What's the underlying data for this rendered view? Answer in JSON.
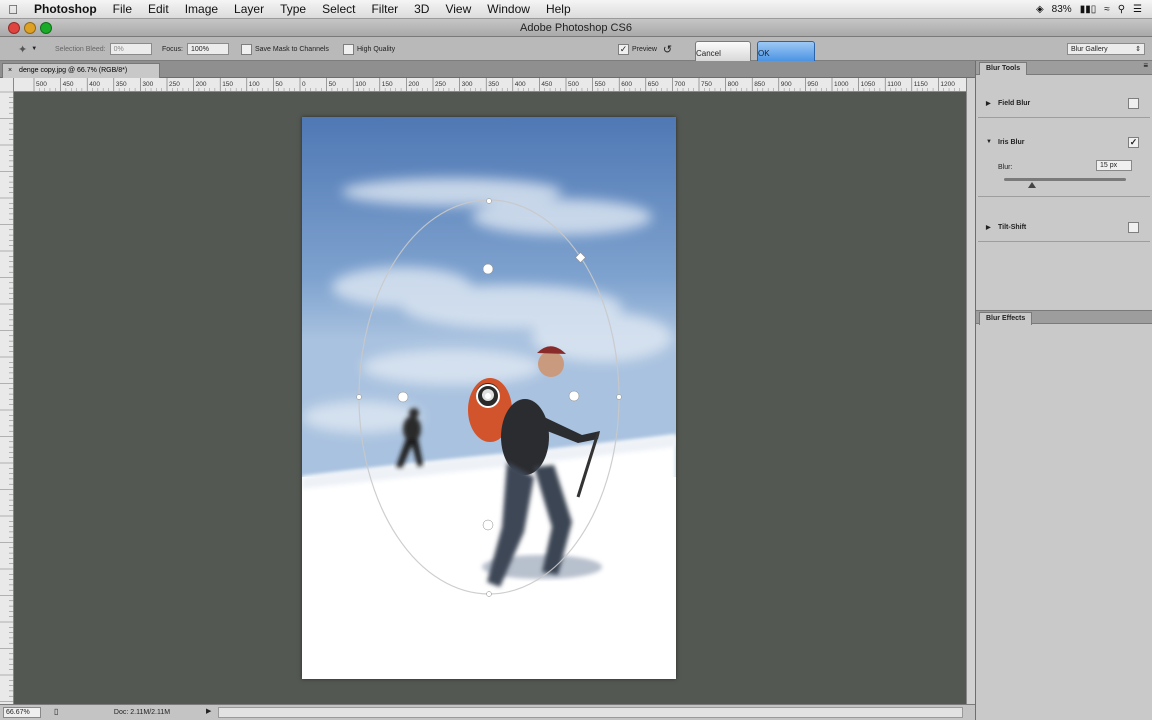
{
  "menubar": {
    "apple_icon": "apple-logo-icon",
    "app_name": "Photoshop",
    "items": [
      "File",
      "Edit",
      "Image",
      "Layer",
      "Type",
      "Select",
      "Filter",
      "3D",
      "View",
      "Window",
      "Help"
    ],
    "battery": "83%"
  },
  "window": {
    "title": "Adobe Photoshop CS6"
  },
  "options_bar": {
    "selection_bleed_label": "Selection Bleed:",
    "selection_bleed_value": "0%",
    "focus_label": "Focus:",
    "focus_value": "100%",
    "save_mask_label": "Save Mask to Channels",
    "high_quality_label": "High Quality",
    "preview_label": "Preview",
    "preview_checked": true,
    "cancel_label": "Cancel",
    "ok_label": "OK",
    "workspace_value": "Blur Gallery"
  },
  "document": {
    "tab_label": "denge copy.jpg @ 66.7% (RGB/8*)",
    "ruler_ticks": [
      "500",
      "450",
      "400",
      "350",
      "300",
      "250",
      "200",
      "150",
      "100",
      "50",
      "0",
      "50",
      "100",
      "150",
      "200",
      "250",
      "300",
      "350",
      "400",
      "450",
      "500",
      "550",
      "600",
      "650",
      "700",
      "750",
      "800",
      "850",
      "900",
      "950",
      "1000",
      "1050",
      "1100",
      "1150",
      "1200"
    ]
  },
  "status_bar": {
    "zoom": "66.67%",
    "doc_info": "Doc: 2.11M/2.11M"
  },
  "blur_tools": {
    "panel_title": "Blur Tools",
    "field_blur": {
      "label": "Field Blur",
      "checked": false
    },
    "iris_blur": {
      "label": "Iris Blur",
      "checked": true
    },
    "blur_label": "Blur:",
    "blur_value": "15 px",
    "blur_slider_fraction": 0.23,
    "tilt_shift": {
      "label": "Tilt-Shift",
      "checked": false
    }
  },
  "blur_effects": {
    "panel_title": "Blur Effects"
  },
  "colors": {
    "workspace_bg": "#545852",
    "ok_button": "#3f8ce0",
    "sky": "#7fa3cf",
    "snow": "#ffffff"
  }
}
